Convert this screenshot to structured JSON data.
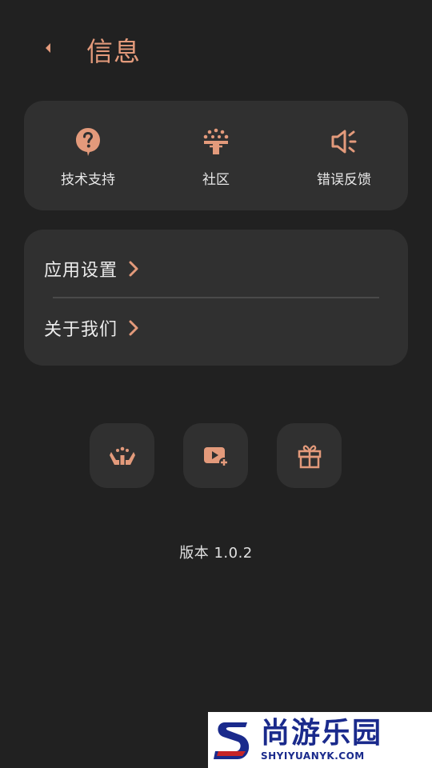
{
  "header": {
    "title": "信息",
    "back_icon": "back-arrow-icon"
  },
  "quick_actions": [
    {
      "label": "技术支持",
      "icon": "help-bubble-icon"
    },
    {
      "label": "社区",
      "icon": "community-icon"
    },
    {
      "label": "错误反馈",
      "icon": "speaker-feedback-icon"
    }
  ],
  "menu": [
    {
      "label": "应用设置",
      "icon": "chevron-right-icon"
    },
    {
      "label": "关于我们",
      "icon": "chevron-right-icon"
    }
  ],
  "action_buttons": [
    {
      "icon": "hands-support-icon"
    },
    {
      "icon": "video-add-icon"
    },
    {
      "icon": "gift-icon"
    }
  ],
  "version": "版本 1.0.2",
  "watermark": {
    "cn": "尚游乐园",
    "en": "SHYIYUANYK.COM"
  },
  "colors": {
    "background": "#212121",
    "card": "#303030",
    "accent": "#e39a7b"
  }
}
